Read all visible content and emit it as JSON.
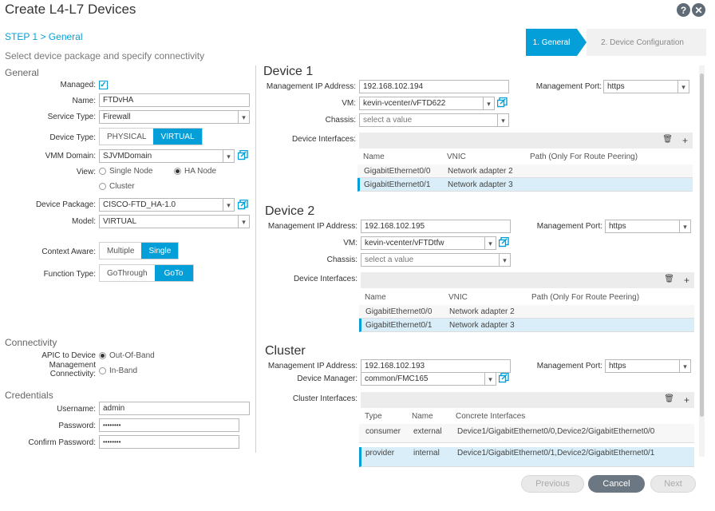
{
  "header": {
    "title": "Create L4-L7 Devices",
    "help_glyph": "?",
    "close_glyph": "✕"
  },
  "step": {
    "link": "STEP 1 > General",
    "subtitle": "Select device package and specify connectivity"
  },
  "wizard": {
    "steps": [
      "1. General",
      "2. Device Configuration"
    ]
  },
  "general": {
    "heading": "General",
    "managed_label": "Managed:",
    "name_label": "Name:",
    "name_value": "FTDvHA",
    "service_type_label": "Service Type:",
    "service_type_value": "Firewall",
    "device_type_label": "Device Type:",
    "device_type_options": [
      "PHYSICAL",
      "VIRTUAL"
    ],
    "vmm_domain_label": "VMM Domain:",
    "vmm_domain_value": "SJVMDomain",
    "view_label": "View:",
    "view_options": [
      "Single Node",
      "HA Node",
      "Cluster"
    ],
    "device_package_label": "Device Package:",
    "device_package_value": "CISCO-FTD_HA-1.0",
    "model_label": "Model:",
    "model_value": "VIRTUAL",
    "context_aware_label": "Context Aware:",
    "context_aware_options": [
      "Multiple",
      "Single"
    ],
    "function_type_label": "Function Type:",
    "function_type_options": [
      "GoThrough",
      "GoTo"
    ]
  },
  "connectivity": {
    "heading": "Connectivity",
    "label_line1": "APIC to Device",
    "label_line2": "Management Connectivity:",
    "options": [
      "Out-Of-Band",
      "In-Band"
    ]
  },
  "credentials": {
    "heading": "Credentials",
    "username_label": "Username:",
    "username_value": "admin",
    "password_label": "Password:",
    "password_value": "••••••••",
    "confirm_label": "Confirm Password:",
    "confirm_value": "••••••••"
  },
  "device1": {
    "heading": "Device 1",
    "mgmt_ip_label": "Management IP Address:",
    "mgmt_ip_value": "192.168.102.194",
    "mgmt_port_label": "Management Port:",
    "mgmt_port_value": "https",
    "vm_label": "VM:",
    "vm_value": "kevin-vcenter/vFTD622",
    "chassis_label": "Chassis:",
    "chassis_placeholder": "select a value",
    "interfaces_label": "Device Interfaces:",
    "columns": [
      "Name",
      "VNIC",
      "Path (Only For Route Peering)"
    ],
    "rows": [
      {
        "name": "GigabitEthernet0/0",
        "vnic": "Network adapter 2"
      },
      {
        "name": "GigabitEthernet0/1",
        "vnic": "Network adapter 3"
      }
    ]
  },
  "device2": {
    "heading": "Device 2",
    "mgmt_ip_label": "Management IP Address:",
    "mgmt_ip_value": "192.168.102.195",
    "mgmt_port_label": "Management Port:",
    "mgmt_port_value": "https",
    "vm_label": "VM:",
    "vm_value": "kevin-vcenter/vFTDtfw",
    "chassis_label": "Chassis:",
    "chassis_placeholder": "select a value",
    "interfaces_label": "Device Interfaces:",
    "columns": [
      "Name",
      "VNIC",
      "Path (Only For Route Peering)"
    ],
    "rows": [
      {
        "name": "GigabitEthernet0/0",
        "vnic": "Network adapter 2"
      },
      {
        "name": "GigabitEthernet0/1",
        "vnic": "Network adapter 3"
      }
    ]
  },
  "cluster": {
    "heading": "Cluster",
    "mgmt_ip_label": "Management IP Address:",
    "mgmt_ip_value": "192.168.102.193",
    "mgmt_port_label": "Management Port:",
    "mgmt_port_value": "https",
    "device_manager_label": "Device Manager:",
    "device_manager_value": "common/FMC165",
    "interfaces_label": "Cluster Interfaces:",
    "columns": [
      "Type",
      "Name",
      "Concrete Interfaces"
    ],
    "rows": [
      {
        "type": "consumer",
        "name": "external",
        "concrete": "Device1/GigabitEthernet0/0,Device2/GigabitEthernet0/0"
      },
      {
        "type": "provider",
        "name": "internal",
        "concrete": "Device1/GigabitEthernet0/1,Device2/GigabitEthernet0/1"
      }
    ]
  },
  "footer": {
    "previous": "Previous",
    "cancel": "Cancel",
    "next": "Next"
  },
  "table_icons": {
    "delete": "🗑",
    "add": "+"
  },
  "colors": {
    "accent": "#049fd9",
    "cancel_button": "#6b7782"
  }
}
